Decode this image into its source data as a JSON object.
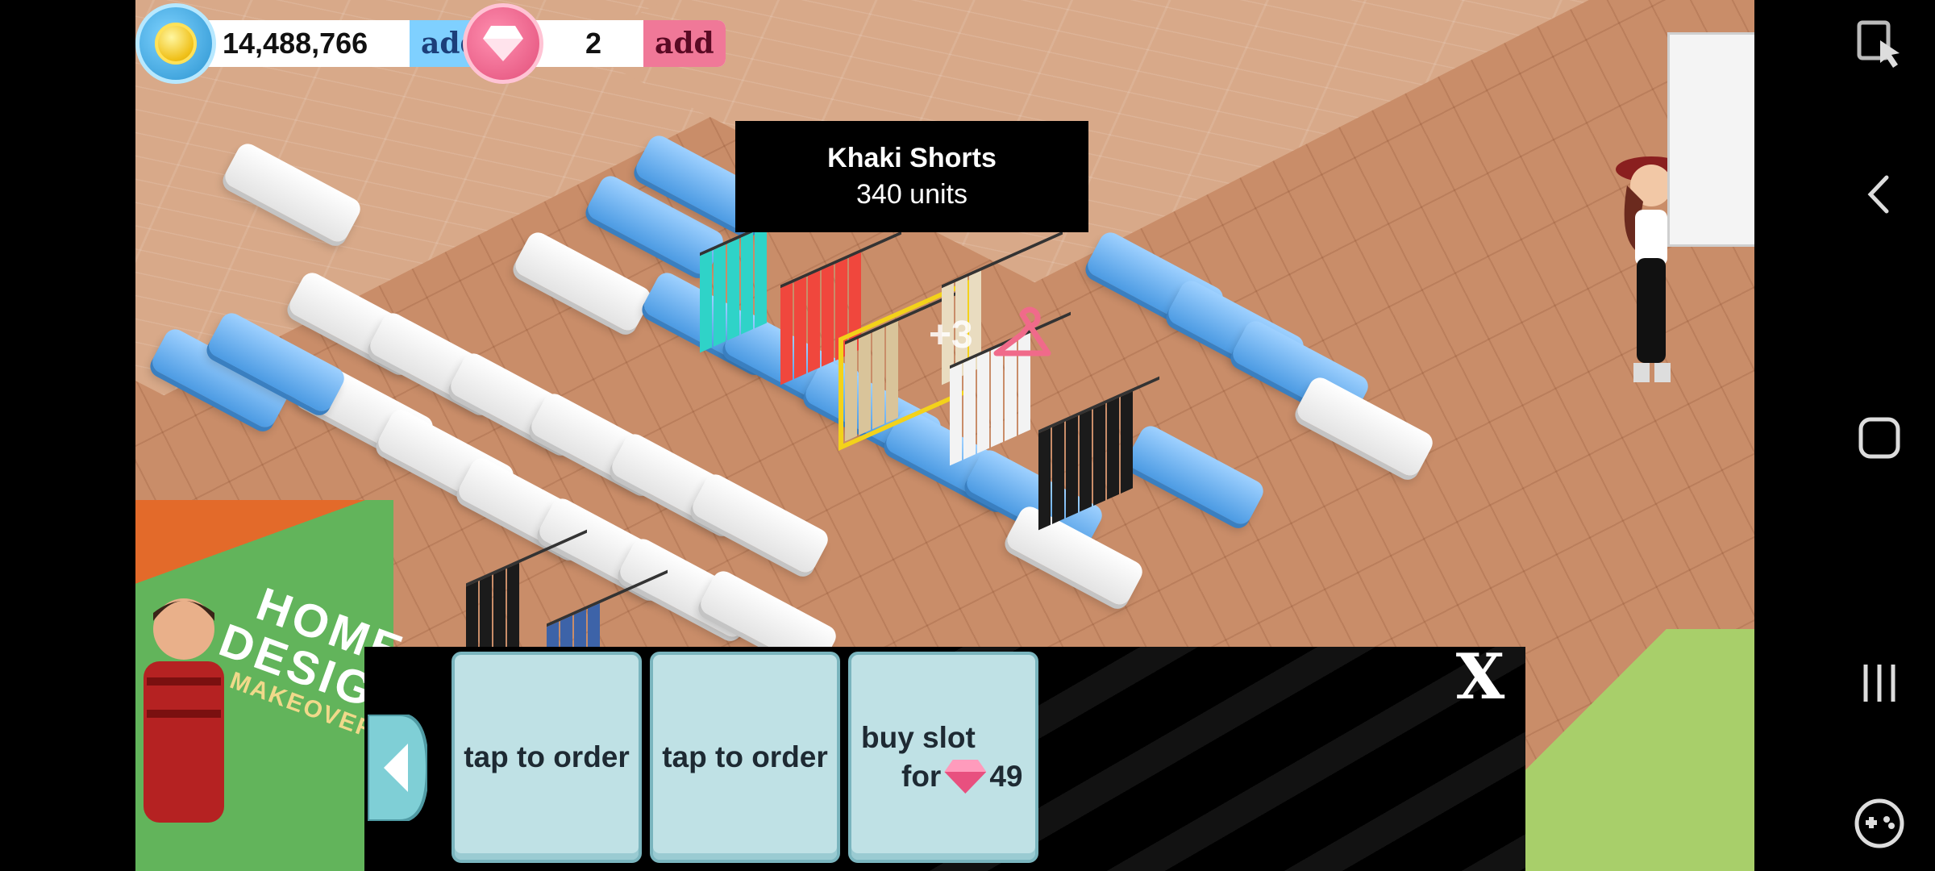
{
  "currency": {
    "coins": "14,488,766",
    "coins_add": "add",
    "gems": "2",
    "gems_add": "add"
  },
  "tooltip": {
    "item_name": "Khaki Shorts",
    "item_units": "340 units"
  },
  "overlay_badge": "+3",
  "ad": {
    "line1": "HOME",
    "line2": "DESIGN",
    "line3": "MAKEOVER"
  },
  "order_panel": {
    "slot1": "tap to order",
    "slot2": "tap to order",
    "buy_slot_line1": "buy slot",
    "buy_slot_for": "for",
    "buy_slot_price": "49",
    "close": "X"
  },
  "icons": {
    "coin": "coin-icon",
    "gem": "gem-icon",
    "hanger": "hanger-icon",
    "back": "back-arrow-icon",
    "nav_screen": "screen-pointer-icon",
    "nav_back": "chevron-left-icon",
    "nav_home": "square-home-icon",
    "nav_recents": "recents-icon",
    "nav_game": "gamepad-icon"
  },
  "colors": {
    "coin_accent": "#7fd0ff",
    "gem_accent": "#f07898",
    "slot_bg": "#bfe1e5",
    "highlight": "#f3d21a"
  }
}
